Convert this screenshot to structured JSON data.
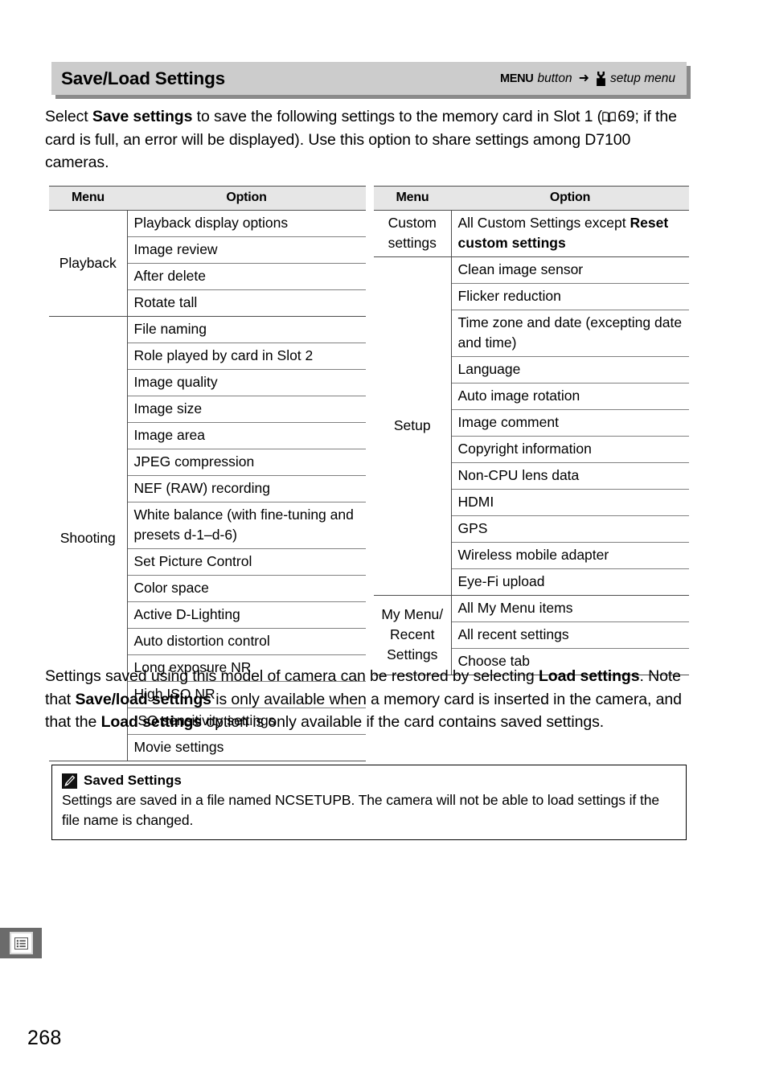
{
  "header": {
    "title": "Save/Load Settings",
    "path": {
      "button_label": "MENU",
      "button_word": "button",
      "arrow": "➜",
      "menu_icon": "wrench-icon",
      "menu_label": "setup menu"
    }
  },
  "intro": {
    "part1": "Select ",
    "bold1": "Save settings",
    "part2": " to save the following settings to the memory card in Slot 1 (",
    "book_icon": "book-icon",
    "part3": "69; if the card is full, an error will be displayed).  Use this option to share settings among D7100 cameras."
  },
  "tables": [
    {
      "id": "left-table",
      "columns": [
        "Menu",
        "Option"
      ],
      "groups": [
        {
          "menu": "Playback",
          "options": [
            "Playback display options",
            "Image review",
            "After delete",
            "Rotate tall"
          ]
        },
        {
          "menu": "Shooting",
          "options": [
            "File naming",
            "Role played by card in Slot 2",
            "Image quality",
            "Image size",
            "Image area",
            "JPEG compression",
            "NEF (RAW) recording",
            "White balance (with fine-tuning and presets d-1–d-6)",
            "Set Picture Control",
            "Color space",
            "Active D-Lighting",
            "Auto distortion control",
            "Long exposure NR",
            "High ISO NR",
            "ISO sensitivity settings",
            "Movie settings"
          ]
        }
      ]
    },
    {
      "id": "right-table",
      "columns": [
        "Menu",
        "Option"
      ],
      "groups": [
        {
          "menu": "Custom settings",
          "options_rich": [
            {
              "plain1": "All Custom Settings except ",
              "bold": "Reset custom settings",
              "plain2": ""
            }
          ]
        },
        {
          "menu": "Setup",
          "options": [
            "Clean image sensor",
            "Flicker reduction",
            "Time zone and date (excepting date and time)",
            "Language",
            "Auto image rotation",
            "Image comment",
            "Copyright information",
            "Non-CPU lens data",
            "HDMI",
            "GPS",
            "Wireless mobile adapter",
            "Eye-Fi upload"
          ]
        },
        {
          "menu": "My Menu/ Recent Settings",
          "options": [
            "All My Menu items",
            "All recent settings",
            "Choose tab"
          ]
        }
      ]
    }
  ],
  "closing": {
    "p1": "Settings saved using this model of camera can be restored by selecting ",
    "b1": "Load settings",
    "p2": ".  Note that ",
    "b2": "Save/load settings",
    "p3": " is only available when a memory card is inserted in the camera, and that the ",
    "b3": "Load settings",
    "p4": " option is only available if the card contains saved settings."
  },
  "note": {
    "icon": "pencil-icon",
    "title": "Saved Settings",
    "body": "Settings are saved in a file named NCSETUPB.  The camera will not be able to load settings if the file name is changed."
  },
  "tab_marker": {
    "icon": "menu-list-icon"
  },
  "page_number": "268"
}
